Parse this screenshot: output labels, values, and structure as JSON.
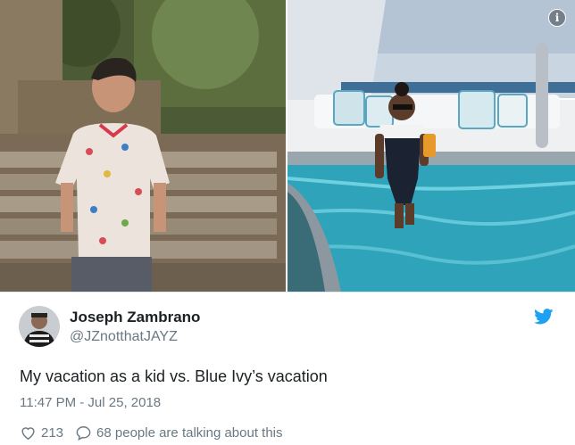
{
  "tweet": {
    "display_name": "Joseph Zambrano",
    "handle": "@JZnotthatJAYZ",
    "text": "My vacation as a kid vs. Blue Ivy’s vacation",
    "timestamp": "11:47 PM - Jul 25, 2018",
    "likes": "213",
    "talking": "68 people are talking about this"
  },
  "media": {
    "info_glyph": "i",
    "icons": [
      "info-icon",
      "twitter-bird-icon",
      "heart-icon",
      "speech-bubble-icon"
    ]
  },
  "colors": {
    "twitter_blue": "#1da1f2",
    "text_primary": "#1c2022",
    "text_secondary": "#697882"
  }
}
